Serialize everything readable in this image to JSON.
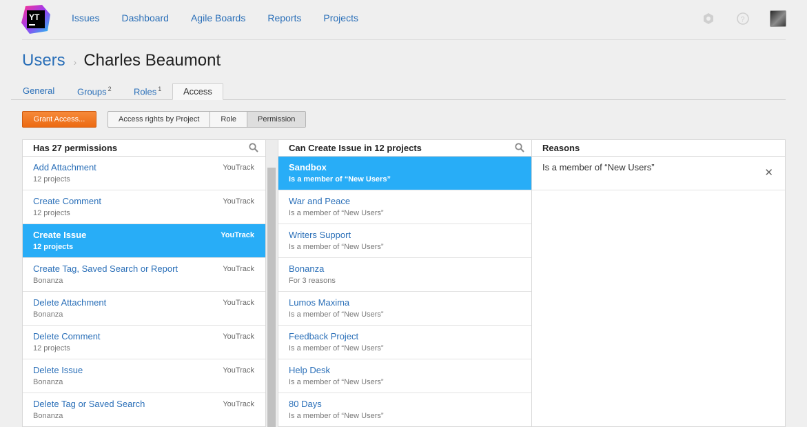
{
  "nav": [
    "Issues",
    "Dashboard",
    "Agile Boards",
    "Reports",
    "Projects"
  ],
  "logo_text": "YT",
  "breadcrumb": {
    "root": "Users",
    "separator": "›",
    "title": "Charles Beaumont"
  },
  "tabs": [
    {
      "label": "General",
      "count": ""
    },
    {
      "label": "Groups",
      "count": "2"
    },
    {
      "label": "Roles",
      "count": "1"
    },
    {
      "label": "Access",
      "count": ""
    }
  ],
  "toolbar": {
    "grant_label": "Grant Access...",
    "view_modes": [
      "Access rights by Project",
      "Role",
      "Permission"
    ],
    "selected_mode": "Permission"
  },
  "permissions": {
    "header": "Has 27 permissions",
    "items": [
      {
        "name": "Add Attachment",
        "sub": "12 projects",
        "tag": "YouTrack"
      },
      {
        "name": "Create Comment",
        "sub": "12 projects",
        "tag": "YouTrack"
      },
      {
        "name": "Create Issue",
        "sub": "12 projects",
        "tag": "YouTrack"
      },
      {
        "name": "Create Tag, Saved Search or Report",
        "sub": "Bonanza",
        "tag": "YouTrack"
      },
      {
        "name": "Delete Attachment",
        "sub": "Bonanza",
        "tag": "YouTrack"
      },
      {
        "name": "Delete Comment",
        "sub": "12 projects",
        "tag": "YouTrack"
      },
      {
        "name": "Delete Issue",
        "sub": "Bonanza",
        "tag": "YouTrack"
      },
      {
        "name": "Delete Tag or Saved Search",
        "sub": "Bonanza",
        "tag": "YouTrack"
      }
    ]
  },
  "projects": {
    "header": "Can Create Issue in 12 projects",
    "items": [
      {
        "name": "Sandbox",
        "sub": "Is a member of “New Users”"
      },
      {
        "name": "War and Peace",
        "sub": "Is a member of “New Users”"
      },
      {
        "name": "Writers Support",
        "sub": "Is a member of “New Users”"
      },
      {
        "name": "Bonanza",
        "sub": "For 3 reasons"
      },
      {
        "name": "Lumos Maxima",
        "sub": "Is a member of “New Users”"
      },
      {
        "name": "Feedback Project",
        "sub": "Is a member of “New Users”"
      },
      {
        "name": "Help Desk",
        "sub": "Is a member of “New Users”"
      },
      {
        "name": "80 Days",
        "sub": "Is a member of “New Users”"
      }
    ]
  },
  "reasons": {
    "header": "Reasons",
    "items": [
      {
        "text": "Is a member of “New Users”"
      }
    ]
  },
  "colors": {
    "accent": "#2a6fb8",
    "selected": "#28adf7",
    "grant": "#ec6a12"
  }
}
